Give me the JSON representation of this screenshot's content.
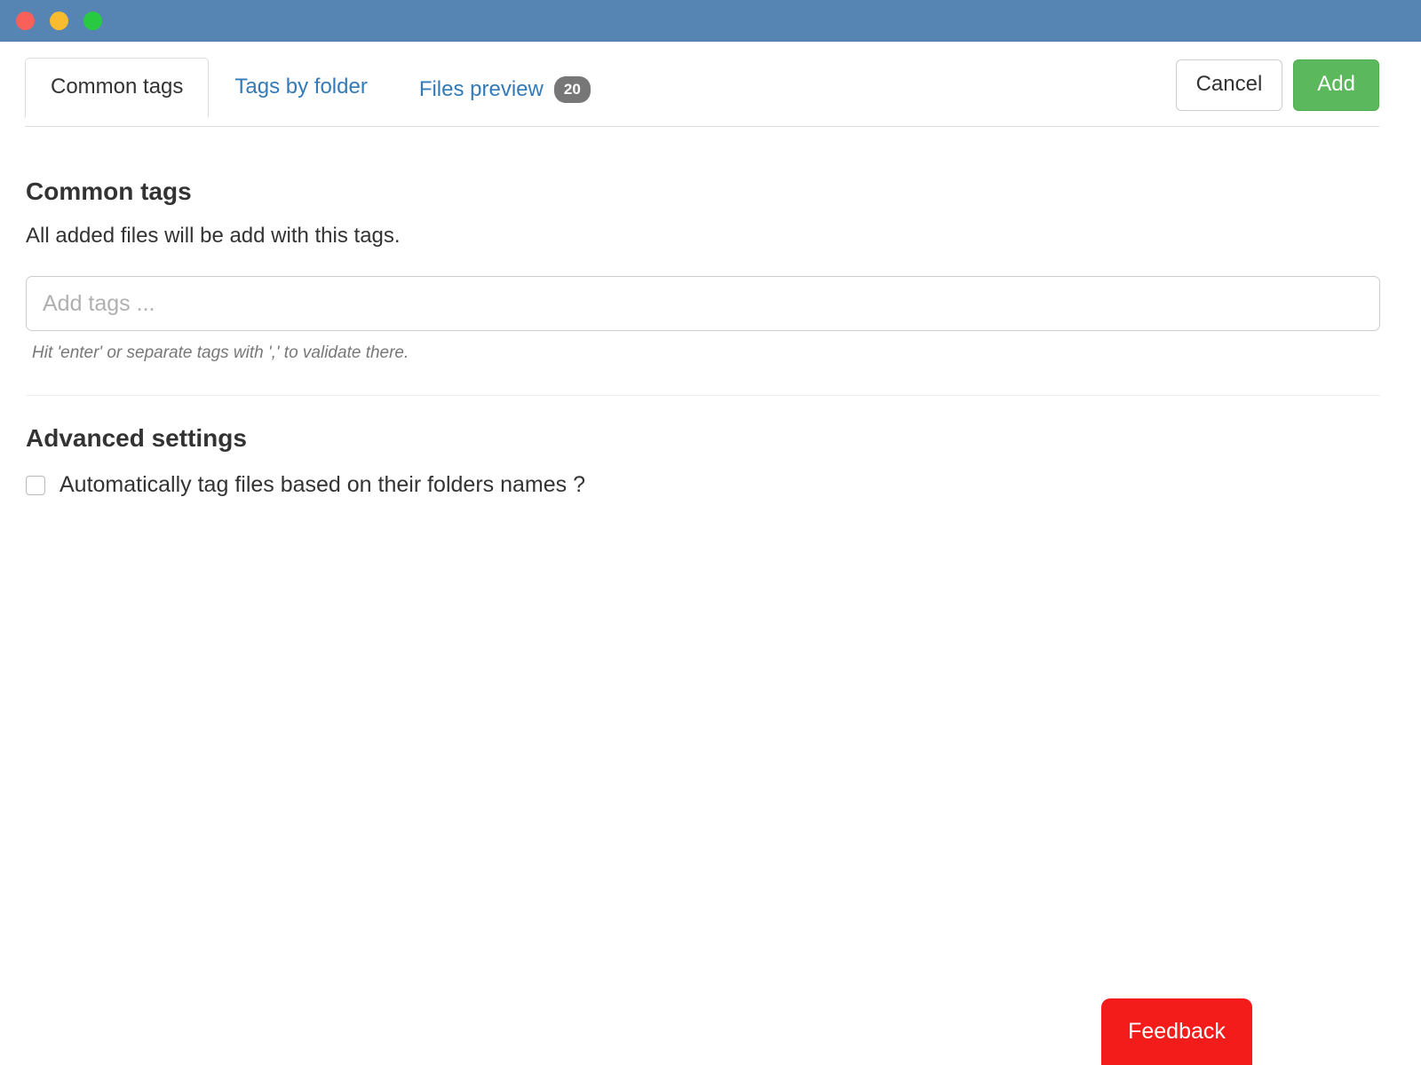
{
  "window": {
    "titlebar_color": "#5685b4",
    "traffic_lights": [
      {
        "name": "close",
        "color": "#f9605a"
      },
      {
        "name": "minimize",
        "color": "#f9bc2f"
      },
      {
        "name": "maximize",
        "color": "#28ca41"
      }
    ]
  },
  "tabs": [
    {
      "label": "Common tags",
      "active": true,
      "badge": null
    },
    {
      "label": "Tags by folder",
      "active": false,
      "badge": null
    },
    {
      "label": "Files preview",
      "active": false,
      "badge": "20"
    }
  ],
  "header_actions": {
    "cancel_label": "Cancel",
    "add_label": "Add",
    "add_color": "#5cb85c"
  },
  "main": {
    "section_title": "Common tags",
    "section_description": "All added files will be add with this tags.",
    "tag_input": {
      "value": "",
      "placeholder": "Add tags ..."
    },
    "input_help": "Hit 'enter' or separate tags with ',' to validate there.",
    "advanced": {
      "title": "Advanced settings",
      "checkbox_label": "Automatically tag files based on their folders names ?",
      "checked": false
    }
  },
  "feedback": {
    "label": "Feedback",
    "color": "#f41b1b"
  }
}
